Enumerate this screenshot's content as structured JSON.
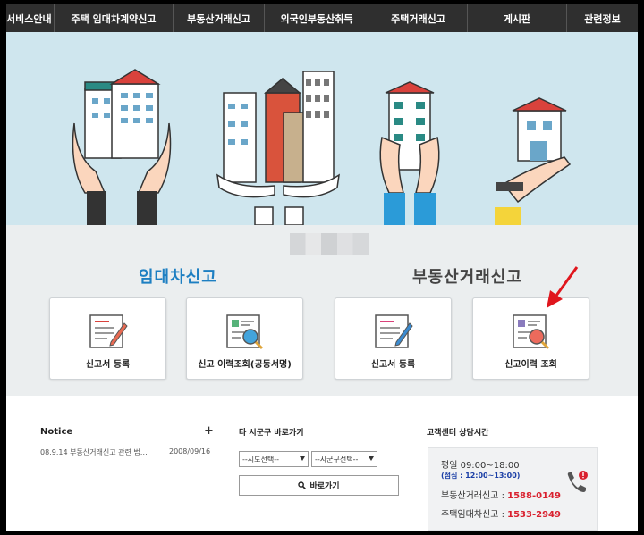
{
  "nav": {
    "items": [
      "서비스안내",
      "주택 임대차계약신고",
      "부동산거래신고",
      "외국인부동산취득",
      "주택거래신고",
      "게시판",
      "관련정보"
    ]
  },
  "services": {
    "rental": {
      "title": "임대차신고",
      "cards": [
        {
          "label": "신고서 등록",
          "icon": "form-pen-icon"
        },
        {
          "label": "신고 이력조회(공동서명)",
          "icon": "history-search-icon"
        }
      ]
    },
    "realestate": {
      "title": "부동산거래신고",
      "cards": [
        {
          "label": "신고서 등록",
          "icon": "form-pen-icon"
        },
        {
          "label": "신고이력 조회",
          "icon": "history-search-icon"
        }
      ]
    }
  },
  "notice": {
    "heading": "Notice",
    "more": "+",
    "items": [
      {
        "title": "08.9.14 부동산거래신고 관련 법…",
        "date": "2008/09/16"
      }
    ]
  },
  "shortcut": {
    "heading": "타 시군구 바로가기",
    "sido_select": "--시도선택--",
    "sigungu_select": "--시군구선택--",
    "go_label": "바로가기"
  },
  "support": {
    "heading": "고객센터 상담시간",
    "hours": "평일 09:00~18:00",
    "lunch": "(점심 : 12:00~13:00)",
    "lines": [
      {
        "label": "부동산거래신고 :",
        "number": "1588-0149"
      },
      {
        "label": "주택임대차신고 :",
        "number": "1533-2949"
      }
    ]
  },
  "colors": {
    "nav_bg": "#2f2f2f",
    "hero_bg": "#cfe6ee",
    "rental_title": "#1d7fc2",
    "realestate_title": "#444444",
    "phone_red": "#d9202e",
    "annotation_arrow": "#e0161d"
  }
}
